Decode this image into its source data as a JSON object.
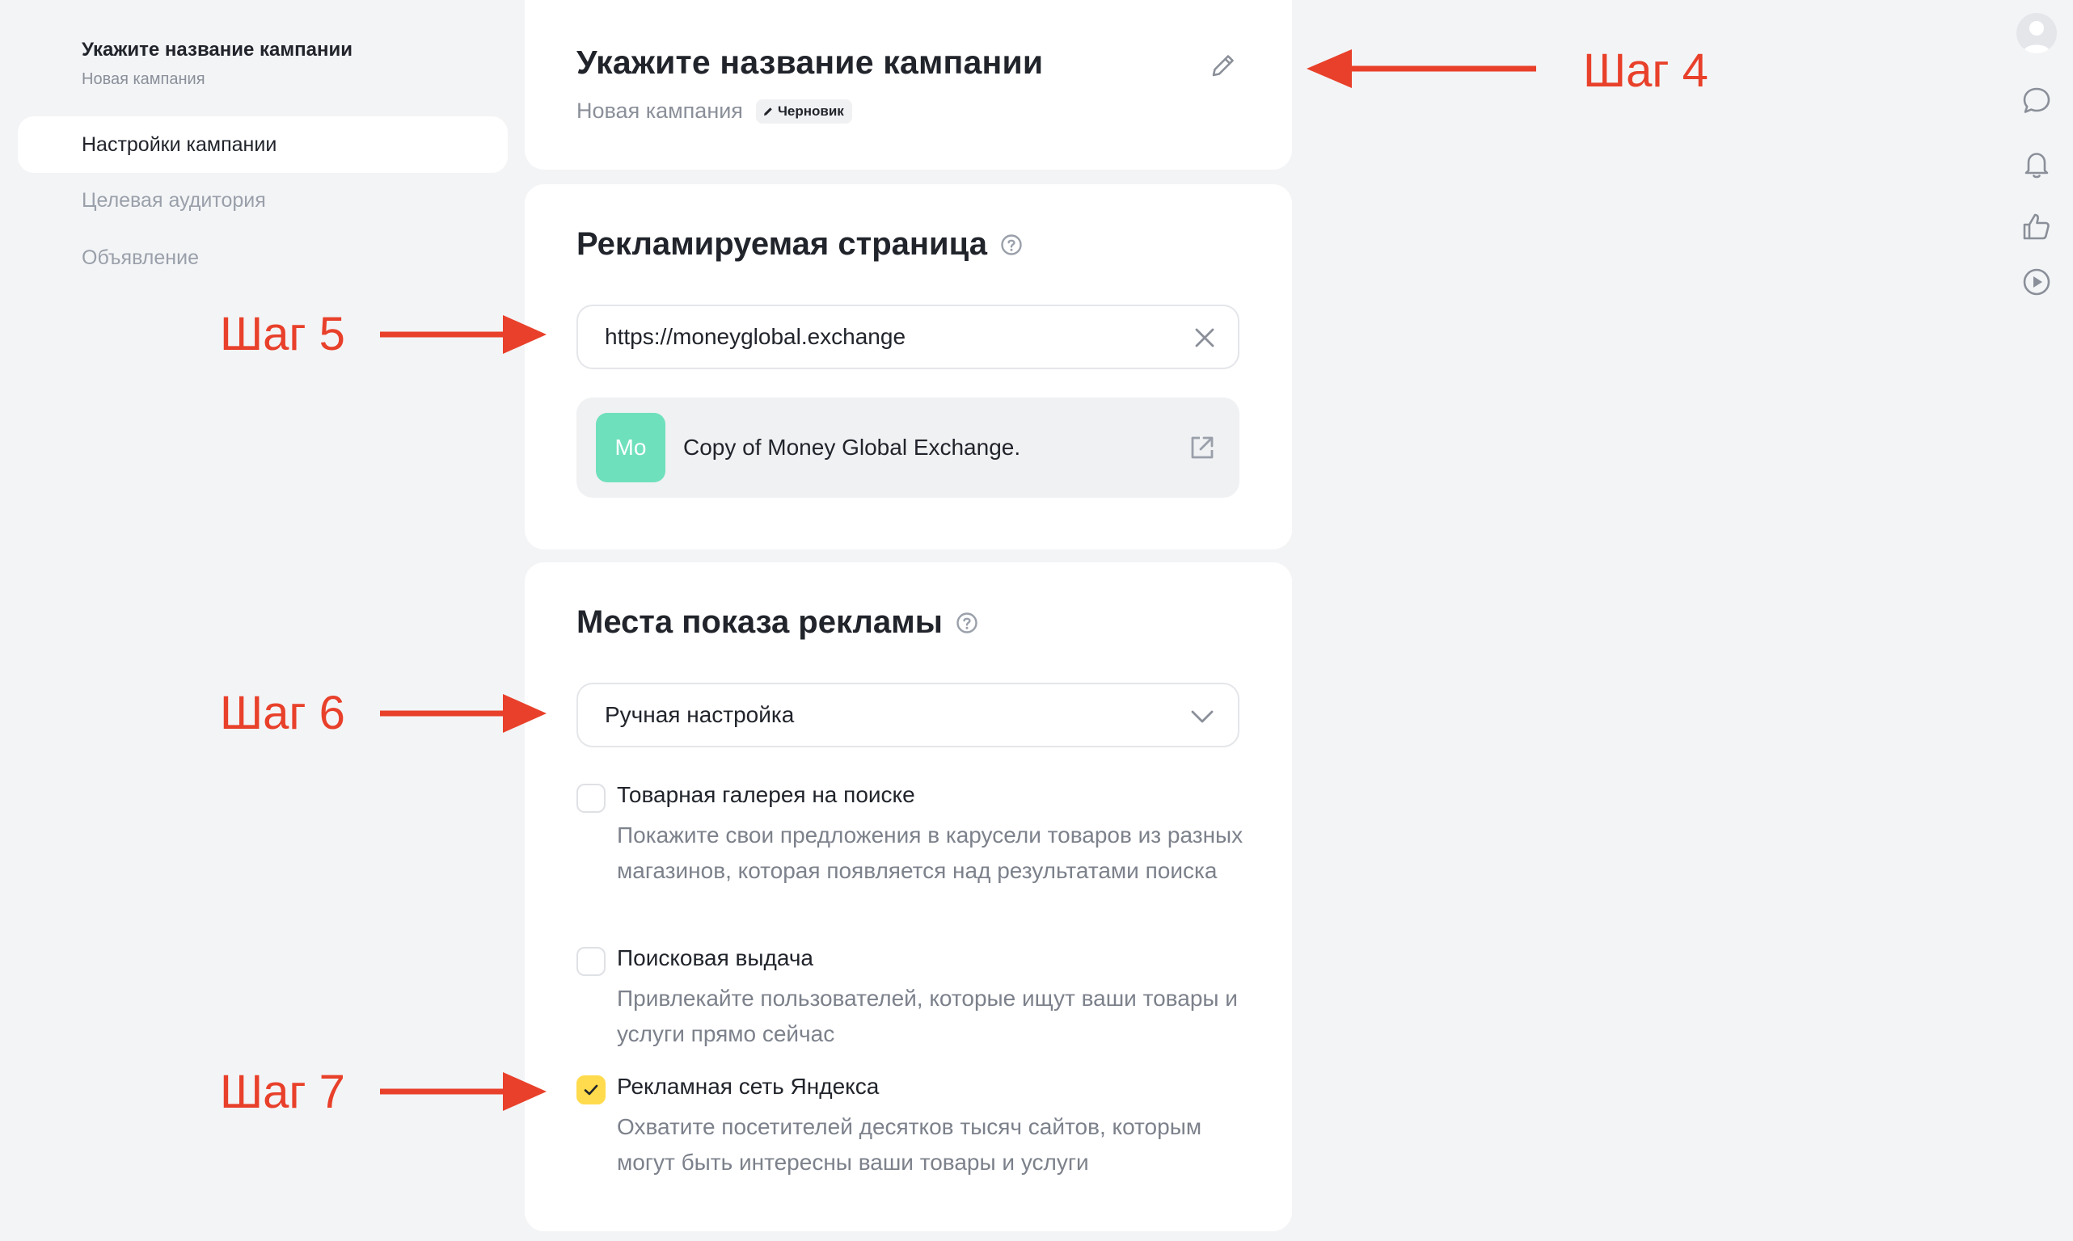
{
  "sidebar": {
    "title": "Укажите название кампании",
    "subtitle": "Новая кампания",
    "items": [
      {
        "label": "Настройки кампании",
        "active": true
      },
      {
        "label": "Целевая аудитория",
        "active": false
      },
      {
        "label": "Объявление",
        "active": false
      }
    ]
  },
  "campaign": {
    "title": "Укажите название кампании",
    "subtitle": "Новая кампания",
    "status_badge": "Черновик",
    "edit_icon": "pencil-icon"
  },
  "page_section": {
    "title": "Рекламируемая страница",
    "url_value": "https://moneyglobal.exchange",
    "preview_initials": "Mo",
    "preview_title": "Copy of Money Global Exchange."
  },
  "placements": {
    "title": "Места показа рекламы",
    "mode_selected": "Ручная настройка",
    "options": [
      {
        "title": "Товарная галерея на поиске",
        "desc": "Покажите свои предложения в карусели товаров из разных магазинов, которая появляется над результатами поиска",
        "checked": false
      },
      {
        "title": "Поисковая выдача",
        "desc": "Привлекайте пользователей, которые ищут ваши товары и услуги прямо сейчас",
        "checked": false
      },
      {
        "title": "Рекламная сеть Яндекса",
        "desc": "Охватите посетителей десятков тысяч сайтов, которым могут быть интересны ваши товары и услуги",
        "checked": true
      }
    ]
  },
  "annotations": {
    "step4": "Шаг 4",
    "step5": "Шаг 5",
    "step6": "Шаг 6",
    "step7": "Шаг 7"
  },
  "rail": [
    "user-avatar-icon",
    "chat-icon",
    "bell-icon",
    "thumbs-up-icon",
    "play-icon"
  ],
  "colors": {
    "background": "#f3f4f6",
    "card": "#ffffff",
    "accent_yellow": "#ffdb4d",
    "annotation_red": "#e8402a",
    "preview_green": "#6fe0bc"
  }
}
